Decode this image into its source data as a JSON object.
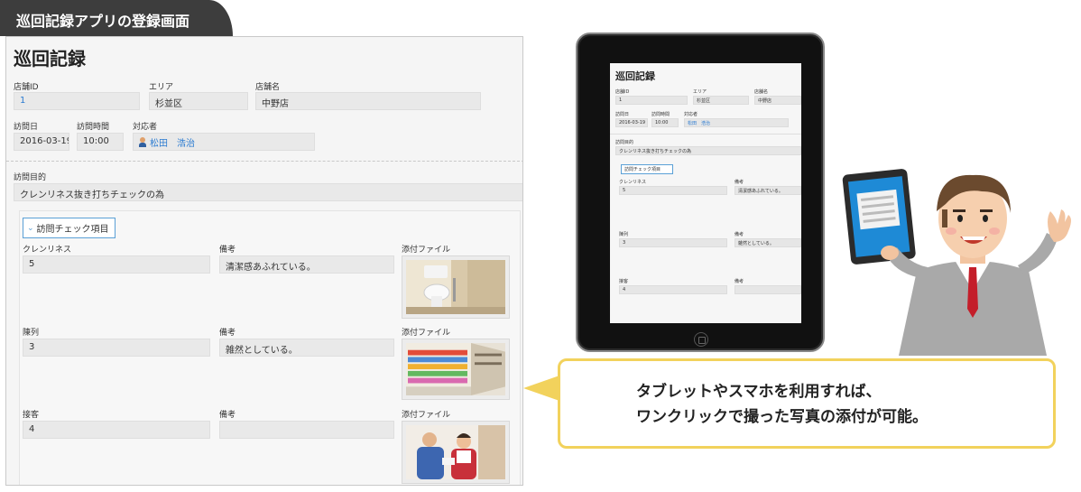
{
  "header": {
    "title": "巡回記録アプリの登録画面"
  },
  "form": {
    "title": "巡回記録",
    "store_id": {
      "label": "店舗ID",
      "value": "1"
    },
    "area": {
      "label": "エリア",
      "value": "杉並区"
    },
    "store_name": {
      "label": "店舗名",
      "value": "中野店"
    },
    "visit_date": {
      "label": "訪問日",
      "value": "2016-03-19"
    },
    "visit_time": {
      "label": "訪問時間",
      "value": "10:00"
    },
    "responder": {
      "label": "対応者",
      "value": "松田　浩治"
    },
    "visit_purpose": {
      "label": "訪問目的",
      "value": "クレンリネス抜き打ちチェックの為"
    },
    "check_group": {
      "label": "訪問チェック項目"
    },
    "items": [
      {
        "label": "クレンリネス",
        "value": "5",
        "note_label": "備考",
        "note": "清潔感あふれている。",
        "file_label": "添付ファイル"
      },
      {
        "label": "陳列",
        "value": "3",
        "note_label": "備考",
        "note": "雑然としている。",
        "file_label": "添付ファイル"
      },
      {
        "label": "接客",
        "value": "4",
        "note_label": "備考",
        "note": "",
        "file_label": "添付ファイル"
      }
    ]
  },
  "bubble": {
    "line1": "タブレットやスマホを利用すれば、",
    "line2": "ワンクリックで撮った写真の添付が可能。"
  },
  "colors": {
    "accent": "#f2d25c",
    "link": "#2b7bd1",
    "header_bg": "#3d3d3d"
  }
}
